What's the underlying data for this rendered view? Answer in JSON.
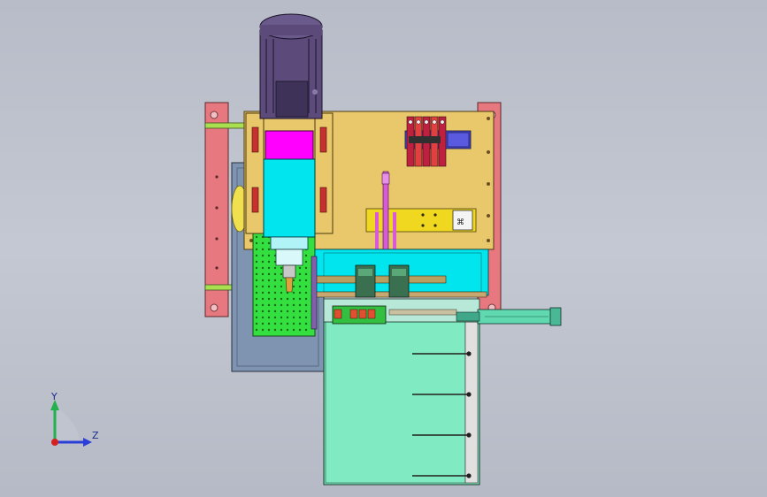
{
  "viewport": {
    "background_top": "#b8bcc8",
    "background_bottom": "#b6bac6"
  },
  "triad": {
    "y_label": "Y",
    "z_label": "Z",
    "y_color": "#22b14c",
    "z_color": "#2b3fd6",
    "x_color": "#d42020"
  },
  "colors": {
    "motor": "#5b4a7a",
    "spindle_body": "#00e5ee",
    "spindle_collar": "#ff00ff",
    "plate_tan": "#e8c86a",
    "side_rail": "#e87880",
    "green_base": "#33e040",
    "teal_box": "#7de8c0",
    "steel_blue": "#7f94b0",
    "cylinder": "#60d8b0",
    "olive_rail": "#b8a060",
    "guide": "#3a7050"
  }
}
